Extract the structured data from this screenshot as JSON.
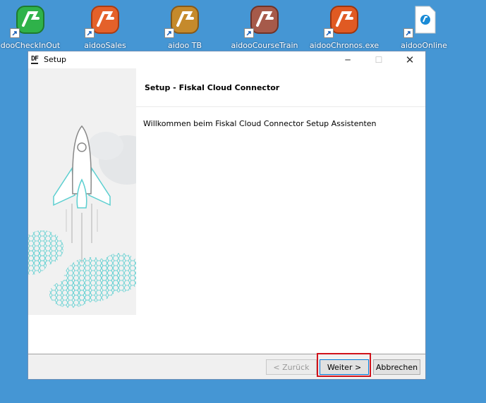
{
  "desktop": {
    "icons": [
      {
        "label": "dooCheckInOut",
        "color": "#2fb24a"
      },
      {
        "label": "aidooSales",
        "color": "#e4612a"
      },
      {
        "label": "aidoo TB",
        "color": "#c58a2c"
      },
      {
        "label": "aidooCourseTrain",
        "color": "#a65a4a"
      },
      {
        "label": "aidooChronos.exe",
        "color": "#e05a23"
      },
      {
        "label": "aidooOnline",
        "color": "#1a8bd6"
      }
    ]
  },
  "window": {
    "logo": "DF",
    "title": "Setup",
    "controls": {
      "minimize": "─",
      "maximize": "☐",
      "close": "✕"
    }
  },
  "wizard": {
    "heading": "Setup - Fiskal Cloud Connector",
    "welcome": "Willkommen beim Fiskal Cloud Connector Setup Assistenten"
  },
  "buttons": {
    "back": "< Zurück",
    "next": "Weiter >",
    "cancel": "Abbrechen"
  },
  "colors": {
    "desktop": "#4596d4",
    "accent_teal": "#5ccfd0",
    "highlight": "#d0121b"
  }
}
